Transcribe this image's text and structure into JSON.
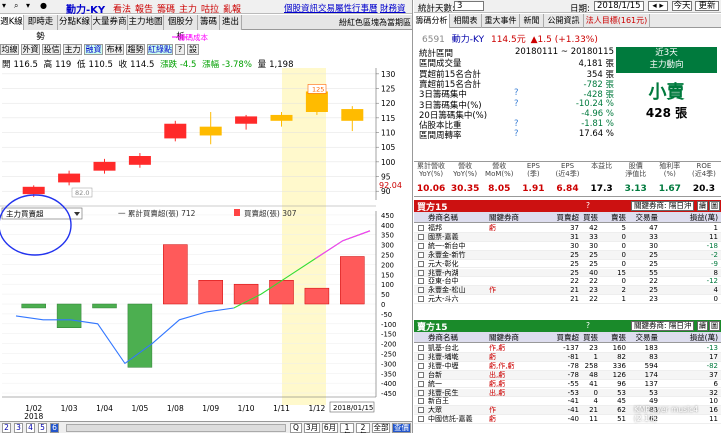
{
  "header": {
    "stock_name": "勤力-KY",
    "menu": [
      "看法",
      "報告",
      "籌碼",
      "主力",
      "咕拉",
      "亂報"
    ],
    "right_links": [
      "個股資訊",
      "交易屬性",
      "行事曆",
      "財務資料"
    ]
  },
  "tabs": [
    {
      "label": "週K線",
      "active": true
    },
    {
      "label": "即時走勢",
      "active": false
    },
    {
      "label": "分點K線",
      "active": false
    },
    {
      "label": "大量券商",
      "active": false
    },
    {
      "label": "主力地圖",
      "active": false
    },
    {
      "label": "個股分析",
      "active": false
    },
    {
      "label": "籌碼",
      "active": false
    },
    {
      "label": "進出",
      "active": false
    }
  ],
  "tabs_note": "紛紅色區塊為當期區",
  "tools": [
    {
      "label": "均線",
      "active": false
    },
    {
      "label": "外資",
      "active": false
    },
    {
      "label": "投信",
      "active": false
    },
    {
      "label": "主力",
      "active": false
    },
    {
      "label": "融資",
      "active": true
    },
    {
      "label": "布林",
      "active": false
    },
    {
      "label": "趨勢",
      "active": false
    },
    {
      "label": "紅綠點",
      "active": true
    },
    {
      "label": "?",
      "active": false
    },
    {
      "label": "設",
      "active": false
    }
  ],
  "ohlc": {
    "open_label": "開",
    "open": "116.5",
    "high_label": "高",
    "high": "119",
    "low_label": "低",
    "low": "110.5",
    "close_label": "收",
    "close": "114.5",
    "change": "漲跌 -4.5",
    "pct": "漲幅 -3.78%",
    "vol_label": "量",
    "vol": "1,198"
  },
  "legend_top": "籌碼成本",
  "legend_price_marker": "125",
  "legend_low_marker": "82.0",
  "current_price": "92.04",
  "lower_select": "主力買賣超",
  "lower_legend_line": "一 累計買賣超(張) 712",
  "lower_legend_bar": "買賣超(張) 307",
  "upper_ticks": [
    "130",
    "125",
    "120",
    "115",
    "110",
    "105",
    "100",
    "95",
    "90"
  ],
  "lower_ticks": [
    "450",
    "400",
    "350",
    "300",
    "250",
    "200",
    "150",
    "100",
    "50",
    "0",
    "-50",
    "-100",
    "-150",
    "-200",
    "-250",
    "-300",
    "-350",
    "-400",
    "-450"
  ],
  "x_labels": [
    "1/02\n2018",
    "1/03",
    "1/04",
    "1/05",
    "1/08",
    "1/09",
    "1/10",
    "1/11",
    "1/12"
  ],
  "x_last_label": "2018/01/15",
  "candles": [
    {
      "o": 89,
      "c": 91.5,
      "h": 92,
      "l": 88
    },
    {
      "o": 93,
      "c": 96,
      "h": 97,
      "l": 92
    },
    {
      "o": 97,
      "c": 100,
      "h": 101,
      "l": 96
    },
    {
      "o": 99,
      "c": 102,
      "h": 103,
      "l": 98
    },
    {
      "o": 108,
      "c": 113,
      "h": 114,
      "l": 107
    },
    {
      "o": 112,
      "c": 109,
      "h": 117,
      "l": 106
    },
    {
      "o": 113,
      "c": 115.5,
      "h": 116,
      "l": 111
    },
    {
      "o": 116,
      "c": 114,
      "h": 117,
      "l": 112
    },
    {
      "o": 124,
      "c": 117,
      "h": 125,
      "l": 116
    },
    {
      "o": 118,
      "c": 114,
      "h": 119,
      "l": 110.5
    }
  ],
  "net_bars": [
    -20,
    -120,
    -20,
    -320,
    300,
    120,
    100,
    120,
    80,
    240
  ],
  "cum_line": [
    -60,
    -80,
    -80,
    -100,
    -300,
    -200,
    -80,
    -40,
    -20,
    50,
    140,
    230,
    320,
    370
  ],
  "bottom": {
    "pages": [
      "2",
      "3",
      "4",
      "5",
      "6"
    ],
    "active_page": "6",
    "ranges": [
      "Q",
      "3月",
      "6月",
      "1年",
      "2年",
      "全部",
      "查價"
    ]
  },
  "right_top": {
    "days_label": "統計天數:",
    "days_value": "3",
    "date_label": "日期:",
    "date_value": "2018/1/15",
    "today_btn": "今天",
    "update_btn": "更新"
  },
  "right_tabs": [
    {
      "label": "籌碼分析",
      "active": true,
      "red": false
    },
    {
      "label": "相關表",
      "active": false,
      "red": false
    },
    {
      "label": "重大事件",
      "active": false,
      "red": false
    },
    {
      "label": "新聞",
      "active": false,
      "red": false
    },
    {
      "label": "公開資訊",
      "active": false,
      "red": false
    },
    {
      "label": "法人目標(161元)",
      "active": false,
      "red": true
    }
  ],
  "quote": {
    "code": "6591",
    "name": "動力-KY",
    "price": "114.5元",
    "change": "▲1.5 (+1.33%)"
  },
  "summary": [
    {
      "k": "統計區間",
      "v": "20180111 ~ 20180115",
      "q": ""
    },
    {
      "k": "區間成交量",
      "v": "4,181 張",
      "q": ""
    },
    {
      "k": "買超前15名合計",
      "v": "354 張",
      "q": ""
    },
    {
      "k": "賣超前15名合計",
      "v": "-782 張",
      "q": ""
    },
    {
      "k": "3日籌碼集中",
      "v": "-428 張",
      "q": "?"
    },
    {
      "k": "3日籌碼集中(%)",
      "v": "-10.24 %",
      "q": "?"
    },
    {
      "k": "20日籌碼集中(%)",
      "v": "-4.96 %",
      "q": ""
    },
    {
      "k": "佔股本比重",
      "v": "-1.81 %",
      "q": "?"
    },
    {
      "k": "區間周轉率",
      "v": "17.64 %",
      "q": "?"
    }
  ],
  "green_box": {
    "line1": "近3天",
    "line2": "主力動向"
  },
  "big_sell": {
    "label": "小賣",
    "qty": "428 張"
  },
  "stats": [
    {
      "h": "累計營收\nYoY(%)",
      "v": "10.06",
      "color": "#cc0000"
    },
    {
      "h": "營收\nYoY(%)",
      "v": "30.35",
      "color": "#cc0000"
    },
    {
      "h": "營收\nMoM(%)",
      "v": "8.05",
      "color": "#cc0000"
    },
    {
      "h": "EPS\n(季)",
      "v": "1.91",
      "color": "#cc0000"
    },
    {
      "h": "EPS\n(近4季)",
      "v": "6.84",
      "color": "#cc0000"
    },
    {
      "h": "本益比",
      "v": "17.3",
      "color": "#000000"
    },
    {
      "h": "股價\n淨值比",
      "v": "3.13",
      "color": "#007a3d"
    },
    {
      "h": "殖利率\n(%)",
      "v": "1.67",
      "color": "#007a3d"
    },
    {
      "h": "ROE\n(近4季)",
      "v": "20.3",
      "color": "#000000"
    }
  ],
  "buy_table": {
    "title": "買方15",
    "select": "關鍵券商: 隔日沖",
    "btn1": "?",
    "btn2": "續",
    "btn3": "圖",
    "cols": [
      "券商名稱",
      "關鍵券商",
      "買賣超",
      "買張",
      "賣張",
      "交易量",
      "損益(萬)"
    ],
    "rows": [
      [
        "福邦",
        "虧",
        "37",
        "42",
        "5",
        "47",
        "1"
      ],
      [
        "國票-嘉義",
        "",
        "31",
        "33",
        "0",
        "33",
        "11"
      ],
      [
        "統一-新台中",
        "",
        "30",
        "30",
        "0",
        "30",
        "-18"
      ],
      [
        "永豐金-新竹",
        "",
        "25",
        "25",
        "0",
        "25",
        "-2"
      ],
      [
        "元大-彰化",
        "",
        "25",
        "25",
        "0",
        "25",
        "-9"
      ],
      [
        "兆豐-內湖",
        "",
        "25",
        "40",
        "15",
        "55",
        "8"
      ],
      [
        "亞東-台中",
        "",
        "22",
        "22",
        "0",
        "22",
        "-12"
      ],
      [
        "永豐金-松山",
        "作",
        "21",
        "23",
        "2",
        "25",
        "4"
      ],
      [
        "元大-斗六",
        "",
        "21",
        "22",
        "1",
        "23",
        "0"
      ]
    ]
  },
  "sell_table": {
    "title": "賣方15",
    "select": "關鍵券商: 隔日沖",
    "btn1": "?",
    "btn2": "續",
    "btn3": "圖",
    "cols": [
      "券商名稱",
      "關鍵券商",
      "買賣超",
      "買張",
      "賣張",
      "交易量",
      "損益(萬)"
    ],
    "rows": [
      [
        "凱基-台北",
        "作,虧",
        "-137",
        "23",
        "160",
        "183",
        "-13"
      ],
      [
        "兆豐-埔墘",
        "虧",
        "-81",
        "1",
        "82",
        "83",
        "17"
      ],
      [
        "兆豐-中壢",
        "虧,作,虧",
        "-78",
        "258",
        "336",
        "594",
        "-82"
      ],
      [
        "台新",
        "出,虧",
        "-78",
        "48",
        "126",
        "174",
        "37"
      ],
      [
        "統一",
        "虧,虧",
        "-55",
        "41",
        "96",
        "137",
        "6"
      ],
      [
        "兆豐-民生",
        "出,虧",
        "-53",
        "0",
        "53",
        "53",
        "32"
      ],
      [
        "新百王",
        "",
        "-41",
        "4",
        "45",
        "49",
        "10"
      ],
      [
        "大眾",
        "作",
        "-41",
        "21",
        "62",
        "83",
        "16"
      ],
      [
        "中國信託-嘉義",
        "虧",
        "-40",
        "11",
        "51",
        "62",
        "11"
      ]
    ]
  },
  "watermark": "KMPlayer music4 (2.11)"
}
